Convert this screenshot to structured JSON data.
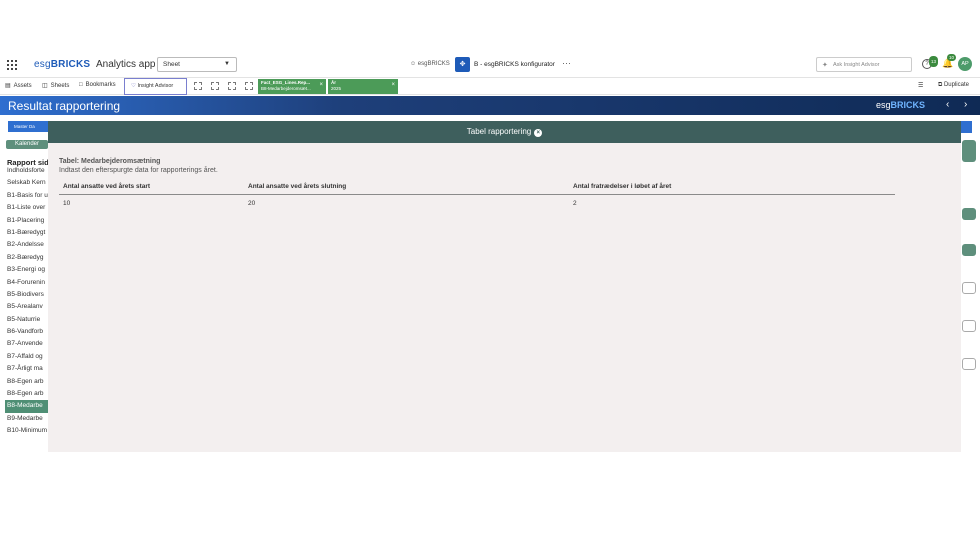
{
  "topbar": {
    "brand_esg": "esg",
    "brand_bricks": "BRICKS",
    "app_title": "Analytics app",
    "sheet_select": "Sheet",
    "user_label": "esgBRICKS",
    "app_name": "B - esgBRICKS konfigurator",
    "ask_placeholder": "Ask Insight Advisor",
    "help_badge": "13",
    "bell_badge": "10",
    "avatar": "AP"
  },
  "toolbar": {
    "assets": "Assets",
    "sheets": "Sheets",
    "bookmarks": "Bookmarks",
    "insight": "Insight Advisor",
    "chip1_line1": "Fact_ESG_Lines.Rep...",
    "chip1_line2": "B8-Medarbejderomsæt...",
    "chip2_line1": "År",
    "chip2_line2": "2025",
    "duplicate": "Duplicate"
  },
  "page": {
    "title": "Resultat rapportering",
    "logo_esg": "esg",
    "logo_bricks": "BRICKS"
  },
  "sheet": {
    "master_button": "Master Da",
    "kalender": "Kalender",
    "rapport_heading": "Rapport side",
    "items": [
      "Indholdsforte",
      "Selskab Kern",
      "B1-Basis for u",
      "B1-Liste over",
      "B1-Placering",
      "B1-Bæredygt",
      "B2-Andelsse",
      "B2-Bæredyg",
      "B3-Energi og",
      "B4-Forurenin",
      "B5-Biodivers",
      "B5-Arealanv",
      "B5-Naturrie",
      "B6-Vandforb",
      "B7-Anvende",
      "B7-Affald og",
      "B7-Årligt ma",
      "B8-Egen arb",
      "B8-Egen arb",
      "B8-Medarbe",
      "B9-Medarbe",
      "B10-Minimum"
    ],
    "active_index": 19
  },
  "modal": {
    "title": "Tabel rapportering",
    "table_label": "Tabel: Medarbejderomsætning",
    "table_desc": "Indtast den efterspurgte data for rapporterings året.",
    "columns": [
      "Antal ansatte ved årets start",
      "Antal ansatte ved årets slutning",
      "Antal fratrædelser i løbet af året"
    ],
    "row": [
      "10",
      "20",
      "2"
    ]
  },
  "colors": {
    "modal_header": "#3e5f5d",
    "modal_body": "#f3efef",
    "brand_blue": "#1e5bb8",
    "active_item": "#4f8f75",
    "chip_green": "#4c9b58"
  }
}
